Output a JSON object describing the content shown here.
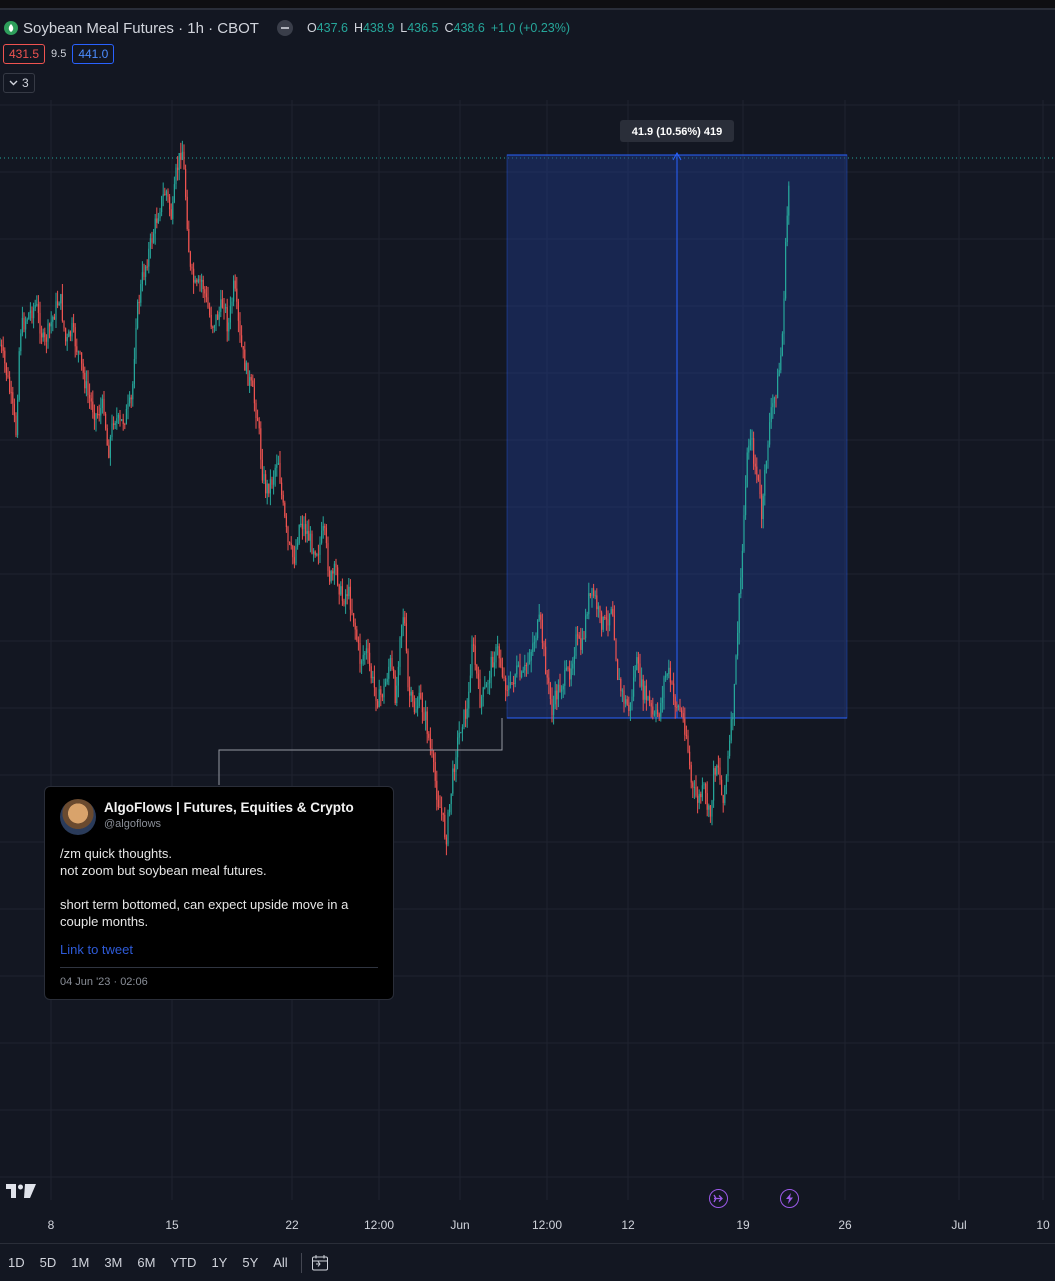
{
  "header": {
    "title": "Soybean Meal Futures · 1h · CBOT",
    "ohlc": [
      {
        "k": "O",
        "v": "437.6"
      },
      {
        "k": "H",
        "v": "438.9"
      },
      {
        "k": "L",
        "v": "436.5"
      },
      {
        "k": "C",
        "v": "438.6"
      },
      {
        "k": "",
        "v": "+1.0 (+0.23%)"
      }
    ],
    "sell_price": "431.5",
    "spread": "9.5",
    "buy_price": "441.0",
    "collapsed_count": "3"
  },
  "chart_data": {
    "type": "candlestick",
    "x_ticks": [
      "8",
      "15",
      "22",
      "12:00",
      "Jun",
      "12:00",
      "12",
      "19",
      "26",
      "Jul",
      "10"
    ],
    "measure_label": "41.9 (10.56%) 419",
    "series_points": [
      [
        0,
        345
      ],
      [
        6,
        370
      ],
      [
        12,
        405
      ],
      [
        16,
        432
      ],
      [
        20,
        330
      ],
      [
        28,
        315
      ],
      [
        36,
        305
      ],
      [
        44,
        345
      ],
      [
        52,
        320
      ],
      [
        60,
        295
      ],
      [
        66,
        345
      ],
      [
        72,
        330
      ],
      [
        80,
        360
      ],
      [
        88,
        395
      ],
      [
        96,
        415
      ],
      [
        104,
        405
      ],
      [
        108,
        455
      ],
      [
        114,
        415
      ],
      [
        120,
        425
      ],
      [
        126,
        415
      ],
      [
        132,
        400
      ],
      [
        136,
        320
      ],
      [
        142,
        280
      ],
      [
        148,
        255
      ],
      [
        154,
        230
      ],
      [
        160,
        205
      ],
      [
        166,
        190
      ],
      [
        172,
        220
      ],
      [
        176,
        175
      ],
      [
        182,
        145
      ],
      [
        186,
        200
      ],
      [
        190,
        270
      ],
      [
        196,
        290
      ],
      [
        202,
        280
      ],
      [
        206,
        300
      ],
      [
        212,
        325
      ],
      [
        218,
        315
      ],
      [
        224,
        300
      ],
      [
        228,
        330
      ],
      [
        234,
        285
      ],
      [
        240,
        340
      ],
      [
        246,
        370
      ],
      [
        252,
        390
      ],
      [
        258,
        420
      ],
      [
        262,
        470
      ],
      [
        266,
        490
      ],
      [
        272,
        480
      ],
      [
        278,
        455
      ],
      [
        282,
        500
      ],
      [
        288,
        545
      ],
      [
        294,
        560
      ],
      [
        300,
        520
      ],
      [
        306,
        530
      ],
      [
        312,
        545
      ],
      [
        318,
        550
      ],
      [
        324,
        530
      ],
      [
        330,
        580
      ],
      [
        336,
        570
      ],
      [
        342,
        600
      ],
      [
        348,
        590
      ],
      [
        354,
        620
      ],
      [
        360,
        660
      ],
      [
        366,
        650
      ],
      [
        372,
        680
      ],
      [
        378,
        700
      ],
      [
        384,
        690
      ],
      [
        390,
        660
      ],
      [
        396,
        700
      ],
      [
        400,
        630
      ],
      [
        404,
        610
      ],
      [
        408,
        690
      ],
      [
        414,
        710
      ],
      [
        420,
        700
      ],
      [
        426,
        720
      ],
      [
        432,
        760
      ],
      [
        438,
        800
      ],
      [
        442,
        815
      ],
      [
        446,
        840
      ],
      [
        450,
        800
      ],
      [
        456,
        750
      ],
      [
        462,
        720
      ],
      [
        468,
        710
      ],
      [
        472,
        640
      ],
      [
        476,
        670
      ],
      [
        480,
        700
      ],
      [
        486,
        690
      ],
      [
        492,
        660
      ],
      [
        498,
        650
      ],
      [
        504,
        680
      ],
      [
        510,
        690
      ],
      [
        516,
        670
      ],
      [
        522,
        680
      ],
      [
        528,
        660
      ],
      [
        534,
        640
      ],
      [
        540,
        620
      ],
      [
        546,
        670
      ],
      [
        552,
        710
      ],
      [
        558,
        690
      ],
      [
        564,
        680
      ],
      [
        570,
        670
      ],
      [
        576,
        640
      ],
      [
        582,
        650
      ],
      [
        588,
        600
      ],
      [
        594,
        595
      ],
      [
        600,
        620
      ],
      [
        606,
        625
      ],
      [
        612,
        600
      ],
      [
        618,
        680
      ],
      [
        624,
        700
      ],
      [
        630,
        710
      ],
      [
        636,
        660
      ],
      [
        642,
        690
      ],
      [
        648,
        700
      ],
      [
        654,
        720
      ],
      [
        660,
        710
      ],
      [
        664,
        680
      ],
      [
        668,
        670
      ],
      [
        674,
        700
      ],
      [
        680,
        710
      ],
      [
        686,
        730
      ],
      [
        692,
        790
      ],
      [
        698,
        800
      ],
      [
        704,
        790
      ],
      [
        710,
        820
      ],
      [
        714,
        770
      ],
      [
        718,
        760
      ],
      [
        722,
        800
      ],
      [
        726,
        780
      ],
      [
        730,
        740
      ],
      [
        734,
        700
      ],
      [
        738,
        620
      ],
      [
        742,
        560
      ],
      [
        746,
        470
      ],
      [
        750,
        430
      ],
      [
        754,
        460
      ],
      [
        758,
        480
      ],
      [
        762,
        520
      ],
      [
        766,
        460
      ],
      [
        770,
        420
      ],
      [
        774,
        400
      ],
      [
        778,
        380
      ],
      [
        782,
        345
      ],
      [
        786,
        240
      ],
      [
        790,
        160
      ]
    ],
    "ylim": [
      120,
      860
    ]
  },
  "tooltip": {
    "author": "AlgoFlows | Futures, Equities & Crypto",
    "handle": "@algoflows",
    "text": "/zm quick thoughts.\nnot zoom but soybean meal futures.\n\nshort term bottomed, can expect upside move in a couple months.",
    "link": "Link to tweet",
    "date": "04 Jun '23 · 02:06"
  },
  "bottom": {
    "ranges": [
      "1D",
      "5D",
      "1M",
      "3M",
      "6M",
      "YTD",
      "1Y",
      "5Y",
      "All"
    ]
  },
  "colors": {
    "up": "#26a69a",
    "down": "#ef5350",
    "accent": "#2962ff",
    "background": "#131722"
  }
}
